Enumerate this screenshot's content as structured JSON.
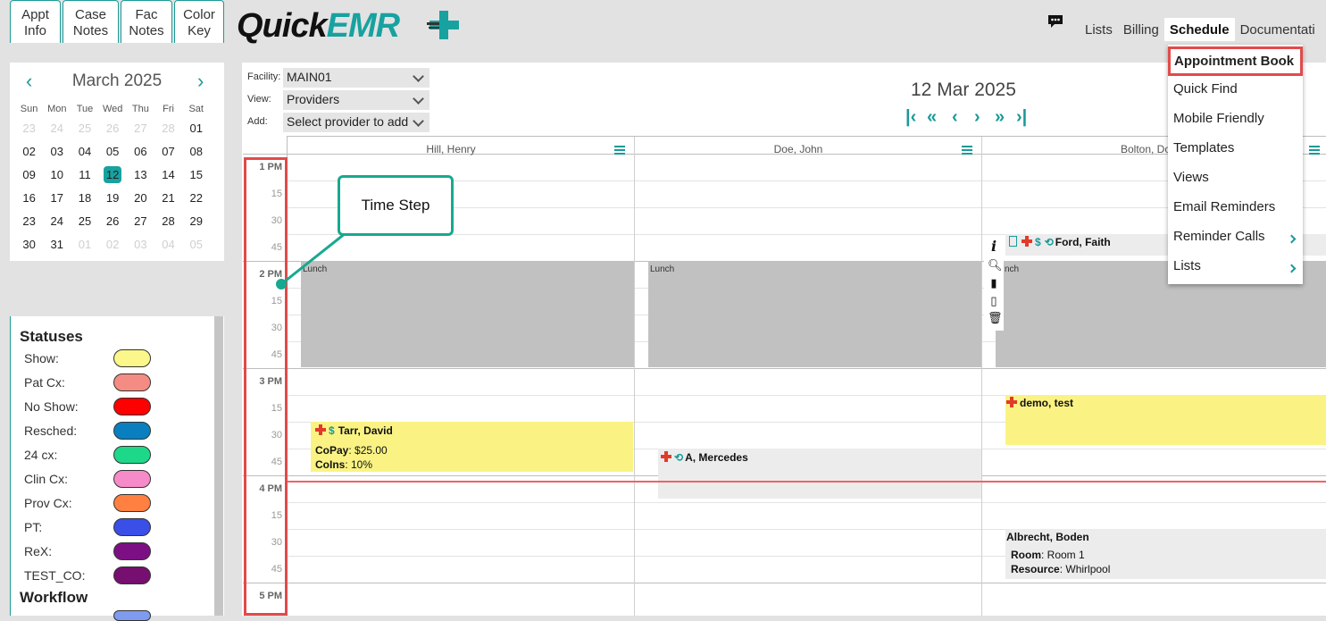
{
  "header": {
    "logo_part1": "Quick",
    "logo_part2": "EMR",
    "nav": [
      "Lists",
      "Billing",
      "Schedule",
      "Documentati"
    ],
    "active_nav": "Schedule",
    "chat_icon": "chat-bubble-icon"
  },
  "calendar": {
    "month_label": "March 2025",
    "weekdays": [
      "Sun",
      "Mon",
      "Tue",
      "Wed",
      "Thu",
      "Fri",
      "Sat"
    ],
    "weeks": [
      [
        "23",
        "24",
        "25",
        "26",
        "27",
        "28",
        "01"
      ],
      [
        "02",
        "03",
        "04",
        "05",
        "06",
        "07",
        "08"
      ],
      [
        "09",
        "10",
        "11",
        "12",
        "13",
        "14",
        "15"
      ],
      [
        "16",
        "17",
        "18",
        "19",
        "20",
        "21",
        "22"
      ],
      [
        "23",
        "24",
        "25",
        "26",
        "27",
        "28",
        "29"
      ],
      [
        "30",
        "31",
        "01",
        "02",
        "03",
        "04",
        "05"
      ]
    ],
    "selected": "12"
  },
  "tabs": [
    {
      "line1": "Appt",
      "line2": "Info"
    },
    {
      "line1": "Case",
      "line2": "Notes"
    },
    {
      "line1": "Fac",
      "line2": "Notes"
    },
    {
      "line1": "Color",
      "line2": "Key"
    }
  ],
  "statuses_title": "Statuses",
  "statuses": [
    {
      "label": "Show:",
      "color": "#fbf78a"
    },
    {
      "label": "Pat Cx:",
      "color": "#f58c84"
    },
    {
      "label": "No Show:",
      "color": "#ff0000"
    },
    {
      "label": "Resched:",
      "color": "#0a7fc0"
    },
    {
      "label": "24 cx:",
      "color": "#1ed88a"
    },
    {
      "label": "Clin Cx:",
      "color": "#f78ac8"
    },
    {
      "label": "Prov Cx:",
      "color": "#ff8040"
    },
    {
      "label": "PT:",
      "color": "#3a4ee8"
    },
    {
      "label": "ReX:",
      "color": "#7d0f84"
    },
    {
      "label": "TEST_CO:",
      "color": "#760f70"
    }
  ],
  "workflow_title": "Workflow",
  "form": {
    "facility_label": "Facility:",
    "facility_value": "MAIN01",
    "view_label": "View:",
    "view_value": "Providers",
    "add_label": "Add:",
    "add_value": "Select provider to add"
  },
  "date_title": "12 Mar 2025",
  "providers": [
    "Hill, Henry",
    "Doe, John",
    "Bolton, Do"
  ],
  "time_labels": [
    {
      "t": "1 PM",
      "hour": true
    },
    {
      "t": "15"
    },
    {
      "t": "30"
    },
    {
      "t": "45"
    },
    {
      "t": "2 PM",
      "hour": true
    },
    {
      "t": "15"
    },
    {
      "t": "30"
    },
    {
      "t": "45"
    },
    {
      "t": "3 PM",
      "hour": true
    },
    {
      "t": "15"
    },
    {
      "t": "30"
    },
    {
      "t": "45"
    },
    {
      "t": "4 PM",
      "hour": true
    },
    {
      "t": "15"
    },
    {
      "t": "30"
    },
    {
      "t": "45"
    },
    {
      "t": "5 PM",
      "hour": true
    }
  ],
  "lunch_label": "Lunch",
  "lunch_label_cropped": "nch",
  "appointments": {
    "tarr": {
      "name": "Tarr, David",
      "copay_label": "CoPay",
      "copay": ": $25.00",
      "coins_label": "CoIns",
      "coins": ": 10%"
    },
    "mercedes": {
      "name": "A, Mercedes"
    },
    "ford": {
      "name": "Ford, Faith"
    },
    "demo": {
      "name": "demo, test"
    },
    "albrecht": {
      "name": "Albrecht, Boden",
      "room_label": "Room",
      "room": ": Room 1",
      "resource_label": "Resource",
      "resource": ": Whirlpool"
    }
  },
  "callout": "Time Step",
  "schedule_menu": [
    "Appointment Book",
    "Quick Find",
    "Mobile Friendly",
    "Templates",
    "Views",
    "Email Reminders",
    "Reminder Calls",
    "Lists"
  ],
  "colors": {
    "accent": "#1a9a97",
    "highlight": "#e24a4a",
    "callout": "#17a98f",
    "lunch": "#c1c1c1",
    "show": "#fbf78a"
  }
}
